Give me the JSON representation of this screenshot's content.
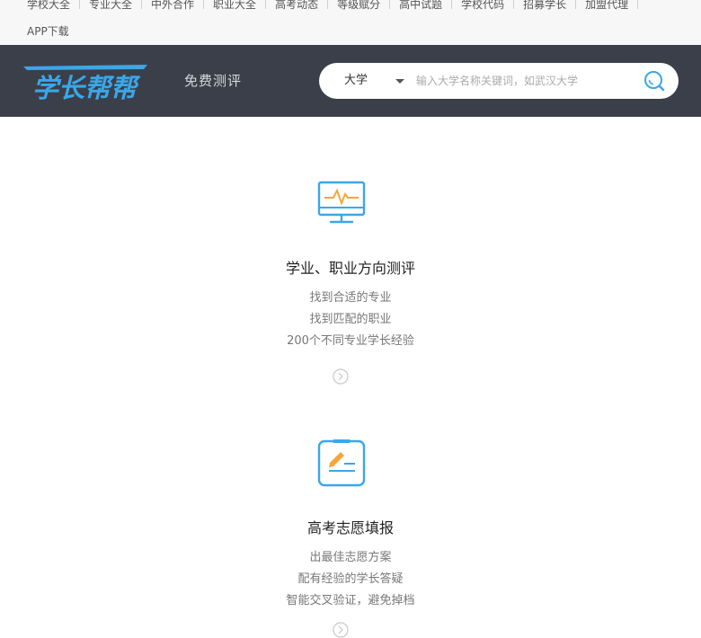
{
  "top_links": [
    "学校大全",
    "专业大全",
    "中外合作",
    "职业大全",
    "高考动态",
    "等级赋分",
    "高中试题",
    "学校代码",
    "招募学长",
    "加盟代理"
  ],
  "app_download": "APP下载",
  "header": {
    "logo_text": "学长帮帮",
    "free_test": "免费测评",
    "search": {
      "type": "大学",
      "placeholder": "输入大学名称关键词，如武汉大学"
    }
  },
  "features": [
    {
      "title": "学业、职业方向测评",
      "lines": [
        "找到合适的专业",
        "找到匹配的职业",
        "200个不同专业学长经验"
      ]
    },
    {
      "title": "高考志愿填报",
      "lines": [
        "出最佳志愿方案",
        "配有经验的学长答疑",
        "智能交叉验证，避免掉档"
      ]
    }
  ],
  "colors": {
    "header_bg": "#3b3f4a",
    "accent_blue": "#3aa7e8",
    "accent_orange": "#f3a73a"
  }
}
